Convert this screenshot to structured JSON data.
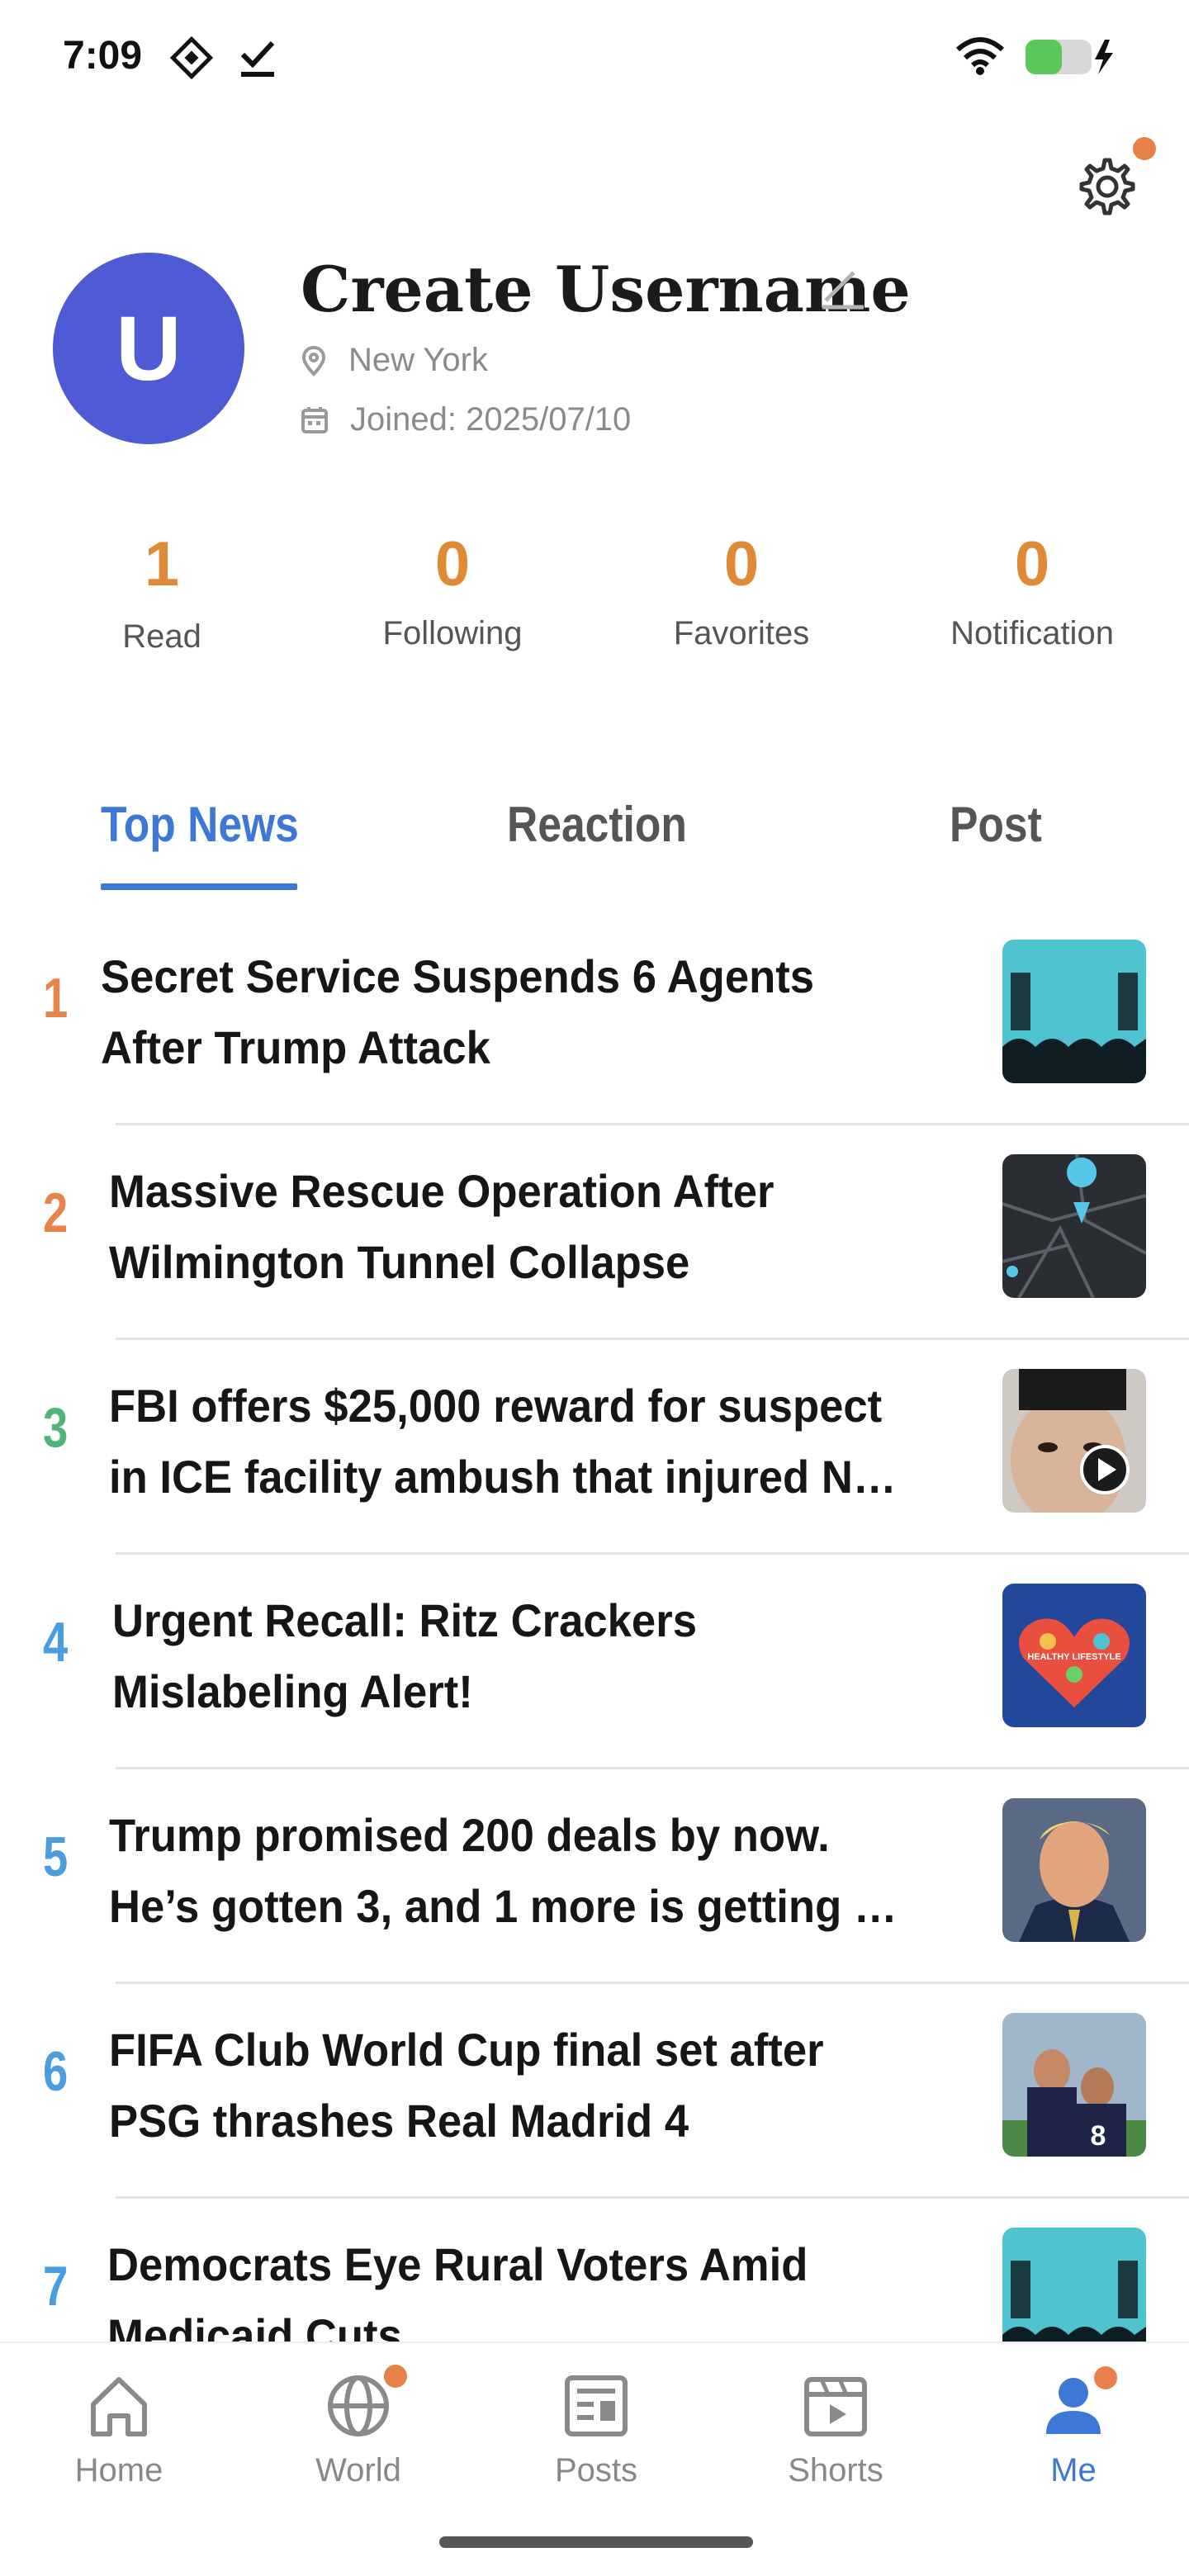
{
  "status_bar": {
    "time": "7:09",
    "icons": [
      "app-diamond-icon",
      "check-icon",
      "wifi-icon",
      "battery-charging-icon"
    ],
    "battery_color": "#5ac85a"
  },
  "settings": {
    "icon": "gear-icon",
    "has_notification_dot": true
  },
  "profile": {
    "avatar_initial": "U",
    "avatar_color": "#4e5bd4",
    "username": "Create Username",
    "location": "New York",
    "joined": "Joined: 2025/07/10"
  },
  "stats": [
    {
      "value": "1",
      "label": "Read"
    },
    {
      "value": "0",
      "label": "Following"
    },
    {
      "value": "0",
      "label": "Favorites"
    },
    {
      "value": "0",
      "label": "Notification"
    }
  ],
  "tabs": [
    {
      "label": "Top News",
      "active": true
    },
    {
      "label": "Reaction",
      "active": false
    },
    {
      "label": "Post",
      "active": false
    }
  ],
  "news": [
    {
      "rank": "1",
      "rank_color": "#e8844a",
      "title": "Secret Service Suspends 6 Agents After Trump Attack",
      "thumb": "rally-stage"
    },
    {
      "rank": "2",
      "rank_color": "#e8844a",
      "title": "Massive Rescue Operation After Wilmington Tunnel Collapse",
      "thumb": "map"
    },
    {
      "rank": "3",
      "rank_color": "#4fb37a",
      "title": "FBI offers $25,000 reward for suspect in ICE facility ambush that injured N…",
      "thumb": "portrait-video"
    },
    {
      "rank": "4",
      "rank_color": "#4a9ee0",
      "title": "Urgent Recall: Ritz Crackers Mislabeling Alert!",
      "thumb": "healthy-lifestyle"
    },
    {
      "rank": "5",
      "rank_color": "#4a9ee0",
      "title": "Trump promised 200 deals by now. He’s gotten 3, and 1 more is getting …",
      "thumb": "trump"
    },
    {
      "rank": "6",
      "rank_color": "#4a9ee0",
      "title": "FIFA Club World Cup final set after PSG thrashes Real Madrid 4",
      "thumb": "soccer"
    },
    {
      "rank": "7",
      "rank_color": "#4a9ee0",
      "title": "Democrats Eye Rural Voters Amid Medicaid Cuts",
      "thumb": "rally-stage"
    }
  ],
  "thumb_text": {
    "healthy": "HEALTHY LIFESTYLE",
    "jersey": "8"
  },
  "nav": [
    {
      "label": "Home",
      "icon": "home-icon",
      "active": false,
      "dot": false
    },
    {
      "label": "World",
      "icon": "globe-icon",
      "active": false,
      "dot": true
    },
    {
      "label": "Posts",
      "icon": "newspaper-icon",
      "active": false,
      "dot": false
    },
    {
      "label": "Shorts",
      "icon": "clapper-icon",
      "active": false,
      "dot": false
    },
    {
      "label": "Me",
      "icon": "person-icon",
      "active": true,
      "dot": true
    }
  ],
  "colors": {
    "accent": "#3e78d6",
    "stat": "#e08a36",
    "dot": "#e8804a"
  }
}
